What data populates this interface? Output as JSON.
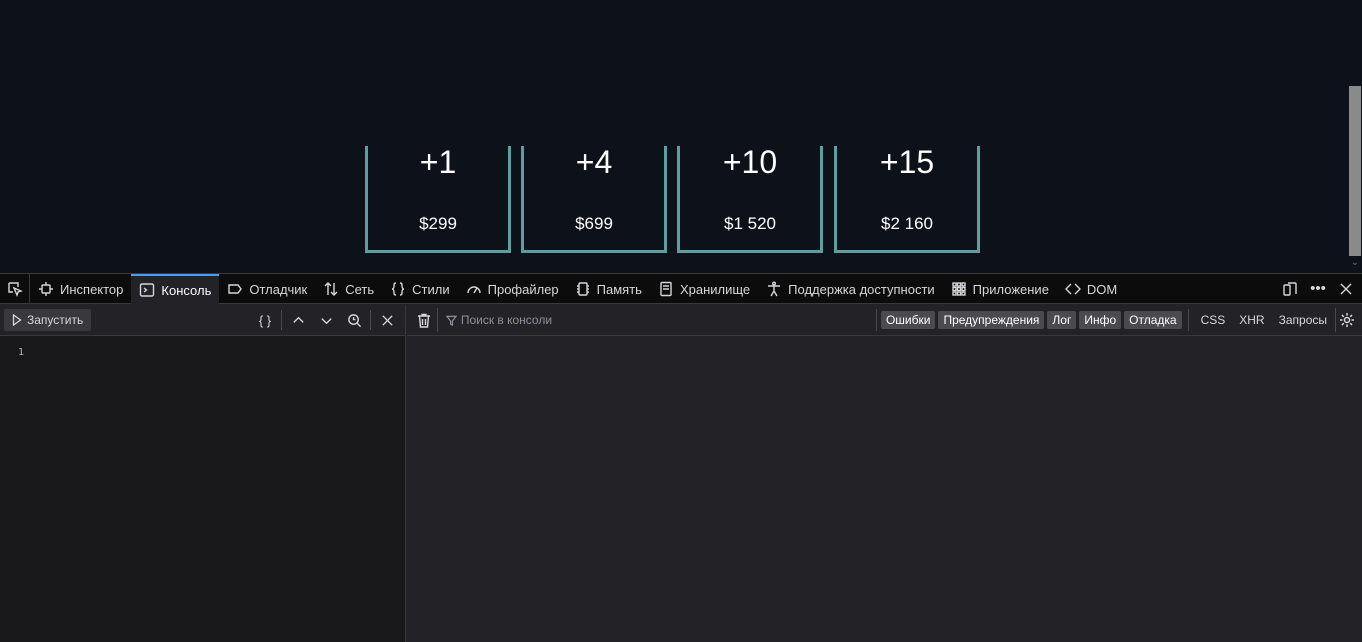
{
  "page": {
    "cards": [
      {
        "amount": "+1",
        "price": "$299"
      },
      {
        "amount": "+4",
        "price": "$699"
      },
      {
        "amount": "+10",
        "price": "$1 520"
      },
      {
        "amount": "+15",
        "price": "$2 160"
      }
    ]
  },
  "devtools": {
    "tabs": [
      {
        "label": "Инспектор",
        "icon": "inspector-icon"
      },
      {
        "label": "Консоль",
        "icon": "console-icon",
        "active": true
      },
      {
        "label": "Отладчик",
        "icon": "debugger-icon"
      },
      {
        "label": "Сеть",
        "icon": "network-icon"
      },
      {
        "label": "Стили",
        "icon": "style-editor-icon"
      },
      {
        "label": "Профайлер",
        "icon": "profiler-icon"
      },
      {
        "label": "Память",
        "icon": "memory-icon"
      },
      {
        "label": "Хранилище",
        "icon": "storage-icon"
      },
      {
        "label": "Поддержка доступности",
        "icon": "accessibility-icon"
      },
      {
        "label": "Приложение",
        "icon": "application-icon"
      },
      {
        "label": "DOM",
        "icon": "dom-icon"
      }
    ],
    "editor": {
      "run_label": "Запустить",
      "pretty_print": "{ }",
      "line_number": "1"
    },
    "output": {
      "filter_placeholder": "Поиск в консоли",
      "levels": [
        "Ошибки",
        "Предупреждения",
        "Лог",
        "Инфо",
        "Отладка"
      ],
      "extra": [
        "CSS",
        "XHR",
        "Запросы"
      ]
    },
    "accent_color": "#4a9aff"
  }
}
